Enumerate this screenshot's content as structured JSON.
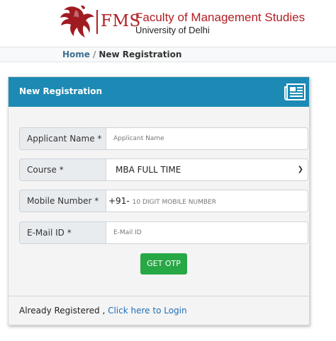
{
  "brand": {
    "abbr": "FMS",
    "title": "Faculty of Management Studies",
    "subtitle": "University of Delhi",
    "accent_color": "#b11e23",
    "logo_icon": "eagle-logo-icon"
  },
  "breadcrumb": {
    "home": "Home",
    "separator": "/",
    "current": "New Registration"
  },
  "card": {
    "title": "New Registration",
    "header_color": "#1c8ab4",
    "header_icon": "newspaper-icon"
  },
  "form": {
    "name": {
      "label": "Applicant Name *",
      "placeholder": "Applicant Name"
    },
    "course": {
      "label": "Course *",
      "value": "MBA FULL TIME"
    },
    "mobile": {
      "label": "Mobile Number *",
      "prefix": "+91-",
      "placeholder": "10 DIGIT MOBILE NUMBER"
    },
    "email": {
      "label": "E-Mail ID *",
      "placeholder": "E-Mail ID"
    },
    "submit_label": "GET OTP",
    "submit_color": "#28a745"
  },
  "footer": {
    "text": "Already Registered ,",
    "link_text": "Click here to Login",
    "link_color": "#1f6fb5"
  }
}
